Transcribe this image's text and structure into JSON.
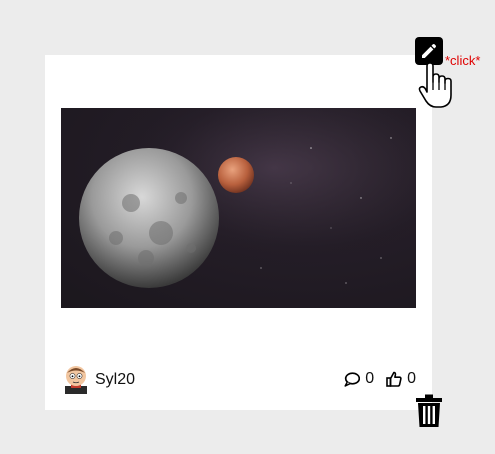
{
  "post": {
    "image_alt": "Moon and Mars in space",
    "author": "Syl20",
    "comments_count": "0",
    "likes_count": "0"
  },
  "overlay": {
    "click_label": "*click*"
  },
  "icons": {
    "edit": "pencil-icon",
    "delete": "trash-icon",
    "comment": "comment-icon",
    "like": "thumbs-up-icon",
    "cursor": "hand-pointer-icon"
  },
  "colors": {
    "background": "#ececec",
    "card": "#ffffff",
    "click_label": "#e00000"
  }
}
